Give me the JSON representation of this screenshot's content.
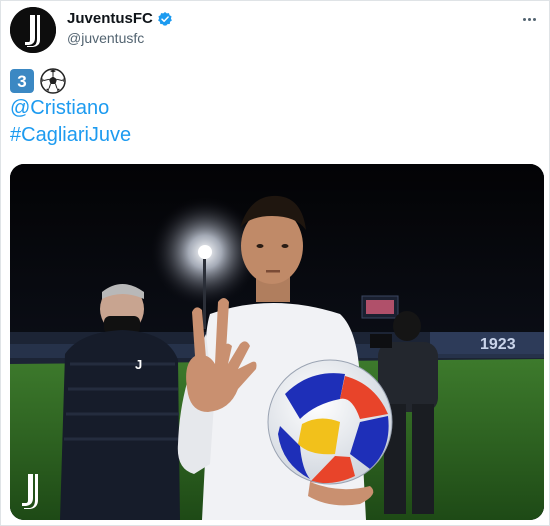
{
  "account": {
    "display_name": "JuventusFC",
    "handle": "@juventusfc",
    "verified": true
  },
  "tweet": {
    "keycap_number": "3",
    "emoji": "soccer-ball",
    "mention": "@Cristiano",
    "hashtag": "#CagliariJuve"
  },
  "media": {
    "description_icons": [
      "juventus-logo-icon",
      "avatar-j-logo-icon"
    ],
    "stadium_banner": "1923"
  },
  "colors": {
    "link": "#1d9bf0",
    "keycap": "#3b88c3",
    "verified": "#1d9bf0",
    "text": "#0f1419",
    "muted": "#536471"
  }
}
